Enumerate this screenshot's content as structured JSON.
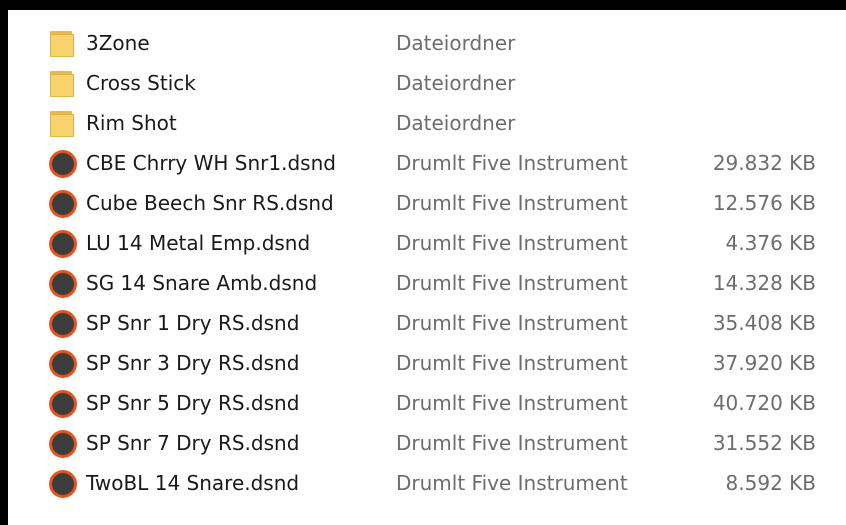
{
  "colors": {
    "frame_background": "#000000",
    "list_background": "#ffffff",
    "folder_icon": "#f6d36d",
    "instrument_icon_ring": "#e8541c",
    "instrument_icon_center": "#3c3c3c"
  },
  "files": [
    {
      "name": "3Zone",
      "type": "Dateiordner",
      "size": "",
      "icon": "folder-icon"
    },
    {
      "name": "Cross Stick",
      "type": "Dateiordner",
      "size": "",
      "icon": "folder-icon"
    },
    {
      "name": "Rim Shot",
      "type": "Dateiordner",
      "size": "",
      "icon": "folder-icon"
    },
    {
      "name": "CBE Chrry WH Snr1.dsnd",
      "type": "Drumlt Five Instrument",
      "size": "29.832 KB",
      "icon": "drumit-instrument-icon"
    },
    {
      "name": "Cube Beech Snr RS.dsnd",
      "type": "Drumlt Five Instrument",
      "size": "12.576 KB",
      "icon": "drumit-instrument-icon"
    },
    {
      "name": "LU 14 Metal Emp.dsnd",
      "type": "Drumlt Five Instrument",
      "size": "4.376 KB",
      "icon": "drumit-instrument-icon"
    },
    {
      "name": "SG 14 Snare Amb.dsnd",
      "type": "Drumlt Five Instrument",
      "size": "14.328 KB",
      "icon": "drumit-instrument-icon"
    },
    {
      "name": "SP Snr 1 Dry RS.dsnd",
      "type": "Drumlt Five Instrument",
      "size": "35.408 KB",
      "icon": "drumit-instrument-icon"
    },
    {
      "name": "SP Snr 3 Dry RS.dsnd",
      "type": "Drumlt Five Instrument",
      "size": "37.920 KB",
      "icon": "drumit-instrument-icon"
    },
    {
      "name": "SP Snr 5 Dry RS.dsnd",
      "type": "Drumlt Five Instrument",
      "size": "40.720 KB",
      "icon": "drumit-instrument-icon"
    },
    {
      "name": "SP Snr 7 Dry RS.dsnd",
      "type": "Drumlt Five Instrument",
      "size": "31.552 KB",
      "icon": "drumit-instrument-icon"
    },
    {
      "name": "TwoBL 14 Snare.dsnd",
      "type": "Drumlt Five Instrument",
      "size": "8.592 KB",
      "icon": "drumit-instrument-icon"
    }
  ]
}
